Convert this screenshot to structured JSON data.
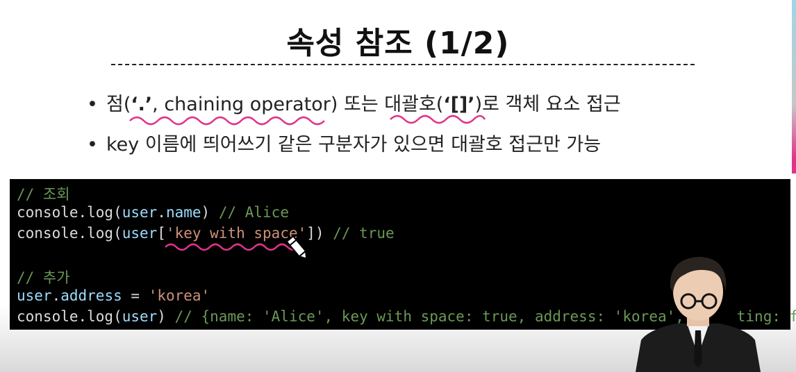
{
  "slide": {
    "title": "속성 참조 (1/2)",
    "bullets": [
      {
        "prefix": "점(",
        "quote_dot": "‘.’",
        "middle": ", chaining operator) 또는 ",
        "bracket_word": "대괄호",
        "paren_open": "(",
        "quote_bracket": "‘[]’",
        "suffix": ")로 객체 요소 접근"
      },
      {
        "key": "key",
        "rest": " 이름에 띄어쓰기 같은 구분자가 있으면 대괄호 접근만 가능"
      }
    ]
  },
  "code": {
    "line1_comment": "// 조회",
    "line2": {
      "a": "console.log(",
      "b": "user",
      "c": ".",
      "d": "name",
      "e": ") ",
      "f": "// Alice"
    },
    "line3": {
      "a": "console.log(",
      "b": "user",
      "c": "[",
      "d": "'key with space'",
      "e": "]) ",
      "f": "// true"
    },
    "line4_comment": "// 추가",
    "line5": {
      "a": "user",
      "b": ".",
      "c": "address",
      "d": " = ",
      "e": "'korea'"
    },
    "line6": {
      "a": "console.log(",
      "b": "user",
      "c": ") ",
      "d": "// {name: 'Alice', key with space: true, address: 'korea', ",
      "e": "     ting: f}"
    }
  },
  "colors": {
    "code_bg": "#000000",
    "comment": "#6a9955",
    "variable": "#9cdcfe",
    "string": "#ce9178",
    "annotation": "#e0338c"
  },
  "icons": [
    "pencil-cursor-icon",
    "speaker-video-icon"
  ]
}
